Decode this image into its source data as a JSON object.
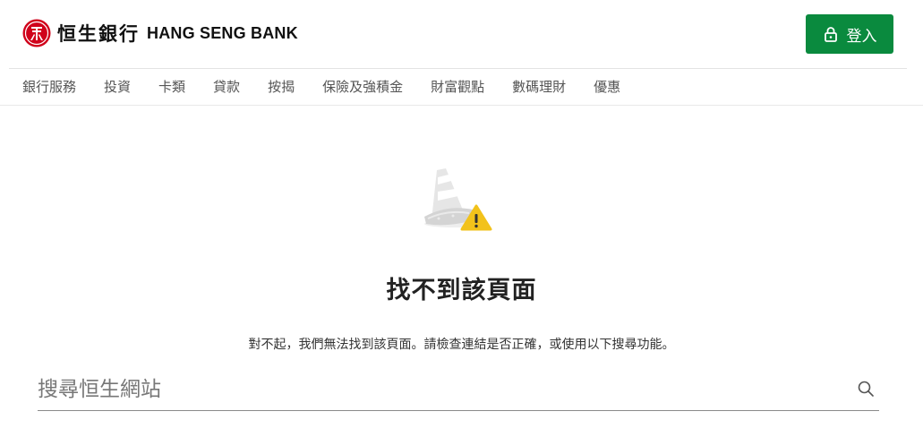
{
  "brand": {
    "name_cn": "恒生銀行",
    "name_en": "HANG SENG BANK",
    "color": "#d0021b"
  },
  "header": {
    "login_label": "登入",
    "login_color": "#0a8a3e",
    "login_icon": "lock-icon"
  },
  "nav": {
    "items": [
      {
        "label": "銀行服務"
      },
      {
        "label": "投資"
      },
      {
        "label": "卡類"
      },
      {
        "label": "貸款"
      },
      {
        "label": "按揭"
      },
      {
        "label": "保險及強積金"
      },
      {
        "label": "財富觀點"
      },
      {
        "label": "數碼理財"
      },
      {
        "label": "優惠"
      }
    ]
  },
  "error": {
    "illustration": "broken-cone-warning-icon",
    "title": "找不到該頁面",
    "description": "對不起，我們無法找到該頁面。請檢查連結是否正確，或使用以下搜尋功能。"
  },
  "search": {
    "placeholder": "搜尋恒生網站",
    "value": "",
    "icon": "search-icon"
  }
}
